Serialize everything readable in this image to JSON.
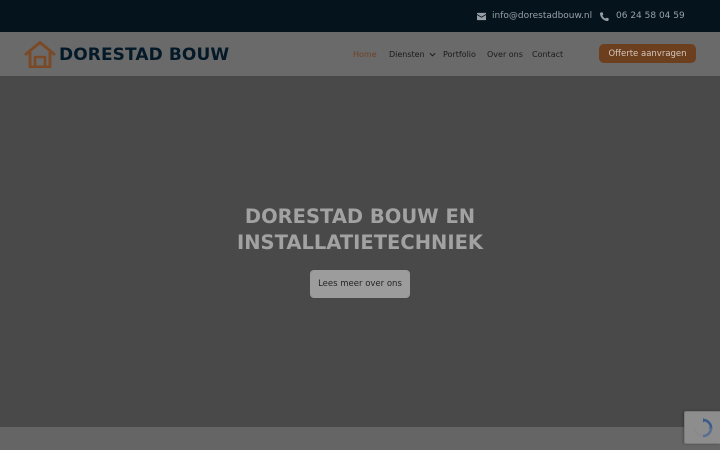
{
  "topbar": {
    "email_icon": "envelope-icon",
    "email": "info@dorestadbouw.nl",
    "phone_icon": "phone-icon",
    "phone": "06 24 58 04 59",
    "bg_color": "#05131d"
  },
  "header": {
    "logo_icon": "house-outline-icon",
    "brand": "DORESTAD BOUW",
    "nav": {
      "home": "Home",
      "diensten": "Diensten",
      "portfolio": "Portfolio",
      "over_ons": "Over ons",
      "contact": "Contact"
    },
    "active_nav": "Home",
    "cta_label": "Offerte aanvragen",
    "accent_color": "#6c3f1f"
  },
  "hero": {
    "title_line1": "DORESTAD BOUW EN",
    "title_line2": "INSTALLATIETECHNIEK",
    "button_label": "Lees meer over ons"
  },
  "recaptcha": {
    "icon": "recaptcha-icon"
  }
}
